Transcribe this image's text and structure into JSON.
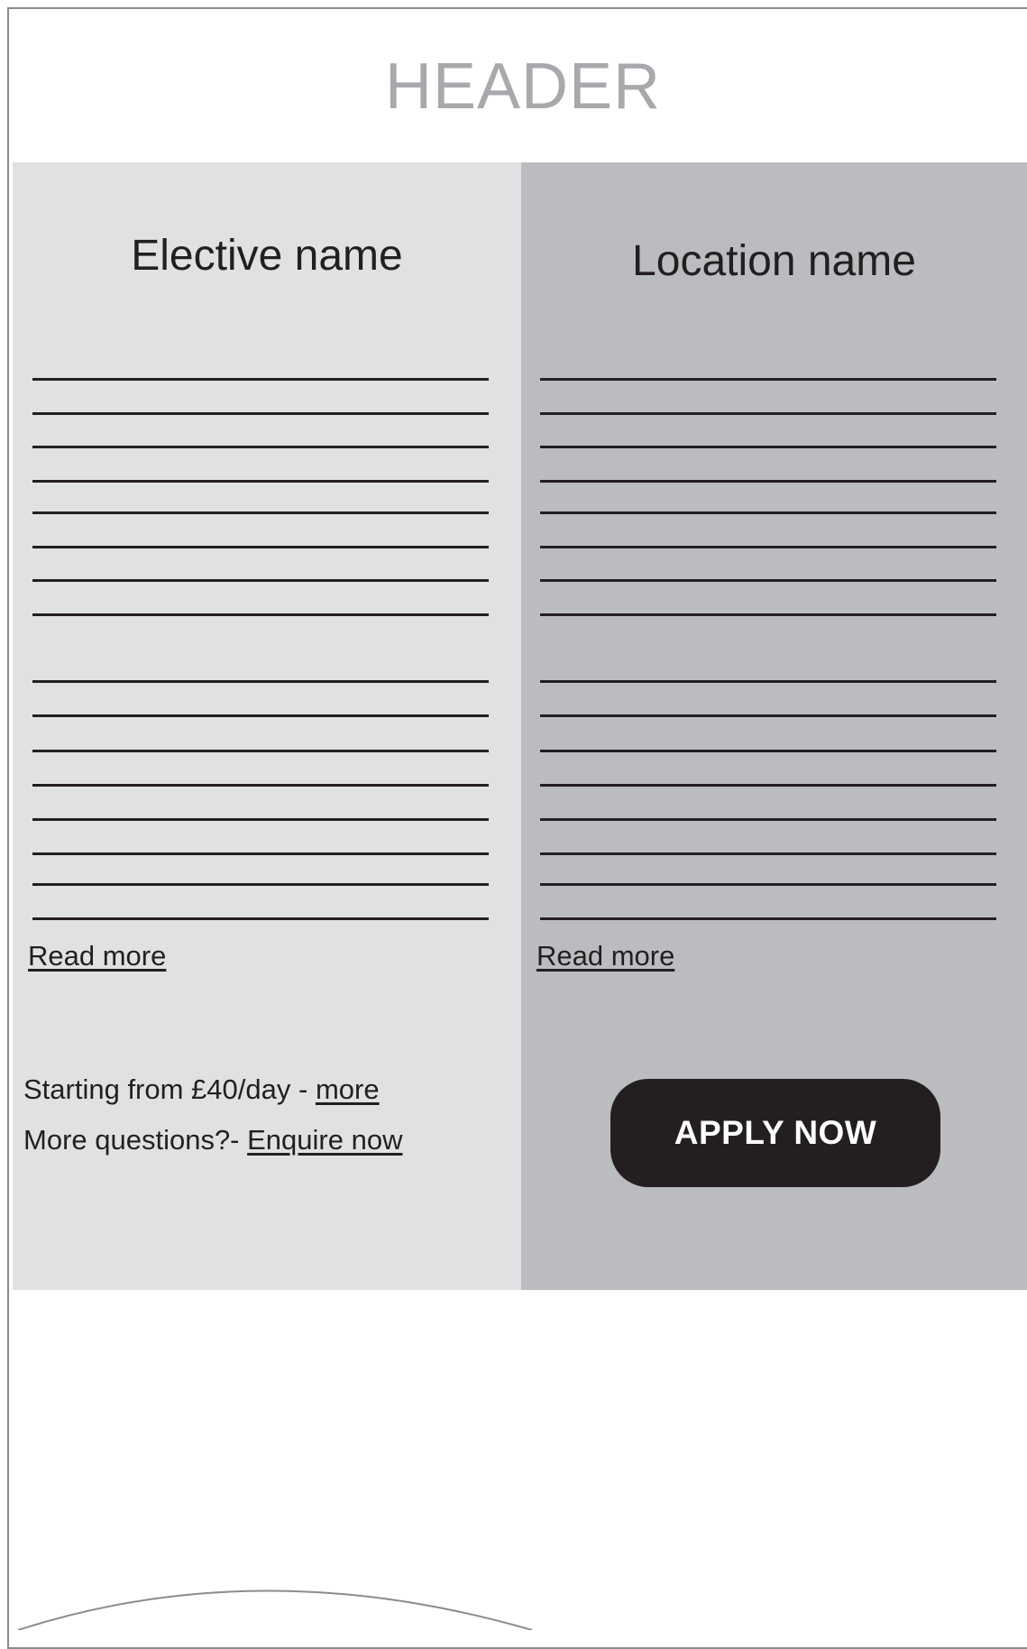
{
  "header": {
    "title": "HEADER"
  },
  "left_panel": {
    "title": "Elective name",
    "read_more": "Read more",
    "price_prefix": "Starting from £40/day - ",
    "price_link": "more",
    "questions_prefix": "More questions?- ",
    "questions_link": "Enquire now"
  },
  "right_panel": {
    "title": "Location name",
    "read_more": "Read more",
    "apply_button": "APPLY NOW"
  },
  "colors": {
    "left_panel_bg": "#e0e1e3",
    "right_panel_bg": "#bbbcbf",
    "header_text": "#a7a9ac",
    "button_bg": "#231f20",
    "button_text": "#ffffff"
  }
}
